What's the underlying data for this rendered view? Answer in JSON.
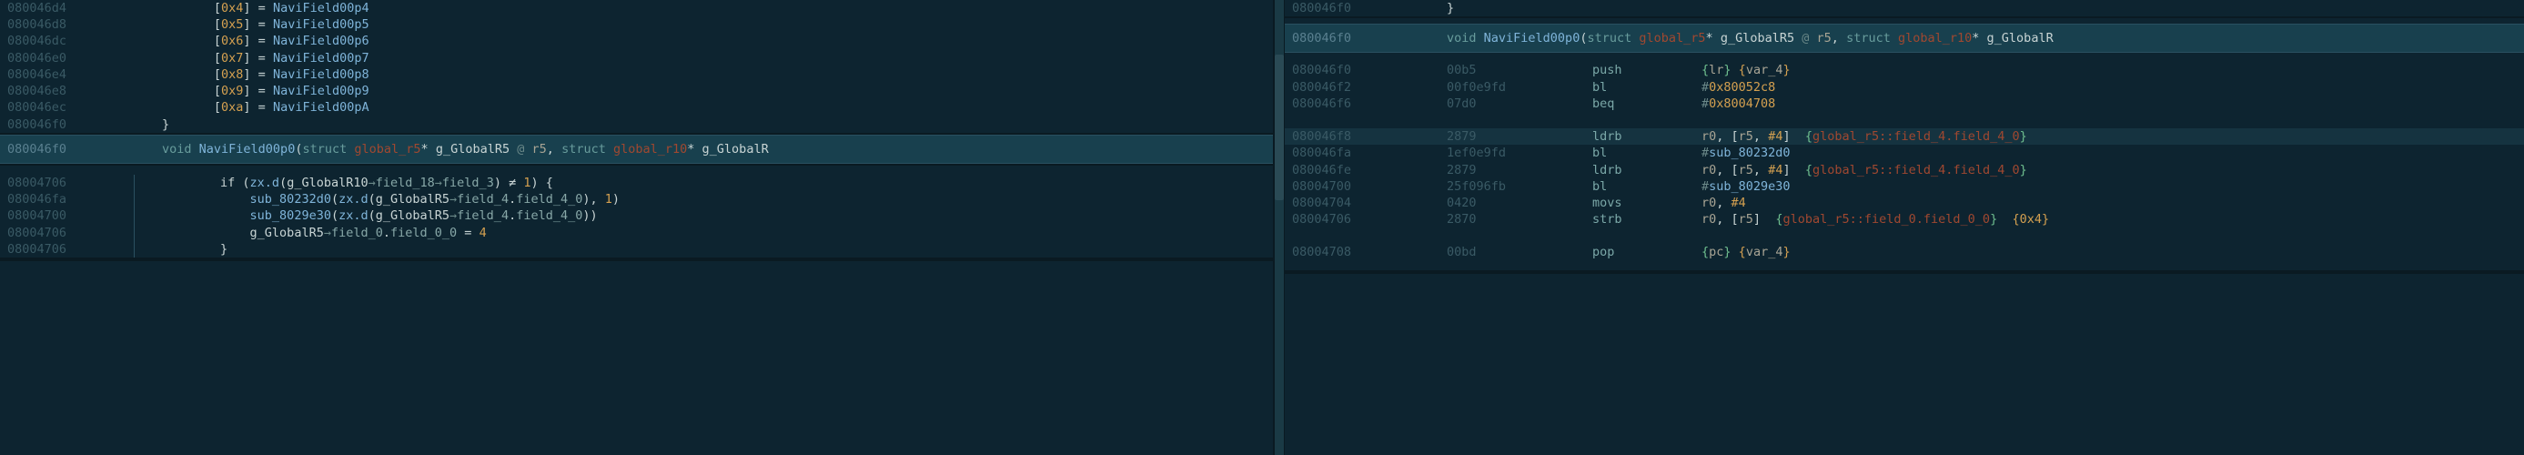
{
  "left": {
    "arrayLines": [
      {
        "addr": "080046d4",
        "idx": "0x4",
        "val": "NaviField00p4"
      },
      {
        "addr": "080046d8",
        "idx": "0x5",
        "val": "NaviField00p5"
      },
      {
        "addr": "080046dc",
        "idx": "0x6",
        "val": "NaviField00p6"
      },
      {
        "addr": "080046e0",
        "idx": "0x7",
        "val": "NaviField00p7"
      },
      {
        "addr": "080046e4",
        "idx": "0x8",
        "val": "NaviField00p8"
      },
      {
        "addr": "080046e8",
        "idx": "0x9",
        "val": "NaviField00p9"
      },
      {
        "addr": "080046ec",
        "idx": "0xa",
        "val": "NaviField00pA"
      }
    ],
    "closeBrace": {
      "addr": "080046f0",
      "text": "}"
    },
    "sig": {
      "addr": "080046f0",
      "kw_void": "void",
      "func": "NaviField00p0",
      "open": "(",
      "kw_struct": "struct",
      "type1": "global_r5",
      "ptr1": "*",
      "param1": "g_GlobalR5",
      "at": "@",
      "reg1": "r5",
      "comma": ", ",
      "kw_struct2": "struct",
      "type2": "global_r10",
      "ptr2": "*",
      "param2": "g_GlobalR"
    },
    "body": [
      {
        "addr": "08004706",
        "indent": "        ",
        "tokens": [
          {
            "t": "if (",
            "c": "c-white"
          },
          {
            "t": "zx.d",
            "c": "c-func"
          },
          {
            "t": "(",
            "c": "c-white"
          },
          {
            "t": "g_GlobalR10",
            "c": "c-white"
          },
          {
            "t": "→",
            "c": "c-punct"
          },
          {
            "t": "field_18",
            "c": "c-field"
          },
          {
            "t": "→",
            "c": "c-punct"
          },
          {
            "t": "field_3",
            "c": "c-field"
          },
          {
            "t": ") ≠ ",
            "c": "c-white"
          },
          {
            "t": "1",
            "c": "c-num"
          },
          {
            "t": ") {",
            "c": "c-white"
          }
        ]
      },
      {
        "addr": "080046fa",
        "indent": "            ",
        "tokens": [
          {
            "t": "sub_80232d0",
            "c": "c-func"
          },
          {
            "t": "(",
            "c": "c-white"
          },
          {
            "t": "zx.d",
            "c": "c-func"
          },
          {
            "t": "(",
            "c": "c-white"
          },
          {
            "t": "g_GlobalR5",
            "c": "c-white"
          },
          {
            "t": "→",
            "c": "c-punct"
          },
          {
            "t": "field_4",
            "c": "c-field"
          },
          {
            "t": ".",
            "c": "c-white"
          },
          {
            "t": "field_4_0",
            "c": "c-field"
          },
          {
            "t": "), ",
            "c": "c-white"
          },
          {
            "t": "1",
            "c": "c-num"
          },
          {
            "t": ")",
            "c": "c-white"
          }
        ]
      },
      {
        "addr": "08004700",
        "indent": "            ",
        "tokens": [
          {
            "t": "sub_8029e30",
            "c": "c-func"
          },
          {
            "t": "(",
            "c": "c-white"
          },
          {
            "t": "zx.d",
            "c": "c-func"
          },
          {
            "t": "(",
            "c": "c-white"
          },
          {
            "t": "g_GlobalR5",
            "c": "c-white"
          },
          {
            "t": "→",
            "c": "c-punct"
          },
          {
            "t": "field_4",
            "c": "c-field"
          },
          {
            "t": ".",
            "c": "c-white"
          },
          {
            "t": "field_4_0",
            "c": "c-field"
          },
          {
            "t": "))",
            "c": "c-white"
          }
        ]
      },
      {
        "addr": "08004706",
        "indent": "            ",
        "tokens": [
          {
            "t": "g_GlobalR5",
            "c": "c-white"
          },
          {
            "t": "→",
            "c": "c-punct"
          },
          {
            "t": "field_0",
            "c": "c-field"
          },
          {
            "t": ".",
            "c": "c-white"
          },
          {
            "t": "field_0_0",
            "c": "c-field"
          },
          {
            "t": " = ",
            "c": "c-white"
          },
          {
            "t": "4",
            "c": "c-num"
          }
        ]
      },
      {
        "addr": "08004706",
        "indent": "        ",
        "tokens": [
          {
            "t": "}",
            "c": "c-white"
          }
        ]
      }
    ]
  },
  "right": {
    "topBrace": {
      "addr": "080046f0",
      "text": "}"
    },
    "sig": {
      "addr": "080046f0",
      "kw_void": "void",
      "func": "NaviField00p0",
      "open": "(",
      "kw_struct": "struct",
      "type1": "global_r5",
      "ptr1": "*",
      "param1": "g_GlobalR5",
      "at": "@",
      "reg1": "r5",
      "comma": ", ",
      "kw_struct2": "struct",
      "type2": "global_r10",
      "ptr2": "*",
      "param2": "g_GlobalR"
    },
    "disasm": [
      {
        "addr": "080046f0",
        "hex": "00b5",
        "mnem": "push",
        "ops": [
          {
            "t": "{",
            "c": "c-brace-g"
          },
          {
            "t": "lr",
            "c": "c-reg"
          },
          {
            "t": "} ",
            "c": "c-brace-g"
          },
          {
            "t": "{",
            "c": "c-brace-y"
          },
          {
            "t": "var_4",
            "c": "c-reg"
          },
          {
            "t": "}",
            "c": "c-brace-y"
          }
        ]
      },
      {
        "addr": "080046f2",
        "hex": "00f0e9fd",
        "mnem": "bl",
        "ops": [
          {
            "t": "#",
            "c": "c-punct"
          },
          {
            "t": "0x80052c8",
            "c": "c-hexlit"
          }
        ]
      },
      {
        "addr": "080046f6",
        "hex": "07d0",
        "mnem": "beq",
        "ops": [
          {
            "t": "#",
            "c": "c-punct"
          },
          {
            "t": "0x8004708",
            "c": "c-hexlit"
          }
        ]
      },
      {
        "blank": true
      },
      {
        "addr": "080046f8",
        "hex": "2879",
        "mnem": "ldrb",
        "hl": true,
        "ops": [
          {
            "t": "r0",
            "c": "c-reg"
          },
          {
            "t": ", [",
            "c": "c-white"
          },
          {
            "t": "r5",
            "c": "c-reg"
          },
          {
            "t": ", ",
            "c": "c-white"
          },
          {
            "t": "#4",
            "c": "c-hexlit"
          },
          {
            "t": "]  ",
            "c": "c-white"
          },
          {
            "t": "{",
            "c": "c-brace-g"
          },
          {
            "t": "global_r5::field_4",
            "c": "c-anno"
          },
          {
            "t": ".",
            "c": "c-anno"
          },
          {
            "t": "field_4_0",
            "c": "c-anno"
          },
          {
            "t": "}",
            "c": "c-brace-g"
          }
        ]
      },
      {
        "addr": "080046fa",
        "hex": "1ef0e9fd",
        "mnem": "bl",
        "ops": [
          {
            "t": "#",
            "c": "c-punct"
          },
          {
            "t": "sub_80232d0",
            "c": "c-func"
          }
        ]
      },
      {
        "addr": "080046fe",
        "hex": "2879",
        "mnem": "ldrb",
        "ops": [
          {
            "t": "r0",
            "c": "c-reg"
          },
          {
            "t": ", [",
            "c": "c-white"
          },
          {
            "t": "r5",
            "c": "c-reg"
          },
          {
            "t": ", ",
            "c": "c-white"
          },
          {
            "t": "#4",
            "c": "c-hexlit"
          },
          {
            "t": "]  ",
            "c": "c-white"
          },
          {
            "t": "{",
            "c": "c-brace-g"
          },
          {
            "t": "global_r5::field_4",
            "c": "c-anno"
          },
          {
            "t": ".",
            "c": "c-anno"
          },
          {
            "t": "field_4_0",
            "c": "c-anno"
          },
          {
            "t": "}",
            "c": "c-brace-g"
          }
        ]
      },
      {
        "addr": "08004700",
        "hex": "25f096fb",
        "mnem": "bl",
        "ops": [
          {
            "t": "#",
            "c": "c-punct"
          },
          {
            "t": "sub_8029e30",
            "c": "c-func"
          }
        ]
      },
      {
        "addr": "08004704",
        "hex": "0420",
        "mnem": "movs",
        "ops": [
          {
            "t": "r0",
            "c": "c-reg"
          },
          {
            "t": ", ",
            "c": "c-white"
          },
          {
            "t": "#4",
            "c": "c-hexlit"
          }
        ]
      },
      {
        "addr": "08004706",
        "hex": "2870",
        "mnem": "strb",
        "ops": [
          {
            "t": "r0",
            "c": "c-reg"
          },
          {
            "t": ", [",
            "c": "c-white"
          },
          {
            "t": "r5",
            "c": "c-reg"
          },
          {
            "t": "]  ",
            "c": "c-white"
          },
          {
            "t": "{",
            "c": "c-brace-g"
          },
          {
            "t": "global_r5::field_0",
            "c": "c-anno"
          },
          {
            "t": ".",
            "c": "c-anno"
          },
          {
            "t": "field_0_0",
            "c": "c-anno"
          },
          {
            "t": "}",
            "c": "c-brace-g"
          },
          {
            "t": "  ",
            "c": "c-white"
          },
          {
            "t": "{",
            "c": "c-brace-y"
          },
          {
            "t": "0x4",
            "c": "c-hexlit"
          },
          {
            "t": "}",
            "c": "c-brace-y"
          }
        ]
      },
      {
        "blank": true
      },
      {
        "addr": "08004708",
        "hex": "00bd",
        "mnem": "pop",
        "ops": [
          {
            "t": "{",
            "c": "c-brace-g"
          },
          {
            "t": "pc",
            "c": "c-reg"
          },
          {
            "t": "} ",
            "c": "c-brace-g"
          },
          {
            "t": "{",
            "c": "c-brace-y"
          },
          {
            "t": "var_4",
            "c": "c-reg"
          },
          {
            "t": "}",
            "c": "c-brace-y"
          }
        ]
      }
    ]
  }
}
